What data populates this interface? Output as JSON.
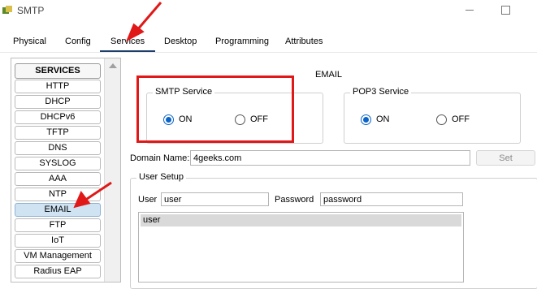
{
  "window": {
    "title": "SMTP"
  },
  "tabs": [
    "Physical",
    "Config",
    "Services",
    "Desktop",
    "Programming",
    "Attributes"
  ],
  "active_tab": "Services",
  "sidebar": {
    "header": "SERVICES",
    "items": [
      "HTTP",
      "DHCP",
      "DHCPv6",
      "TFTP",
      "DNS",
      "SYSLOG",
      "AAA",
      "NTP",
      "EMAIL",
      "FTP",
      "IoT",
      "VM Management",
      "Radius EAP"
    ],
    "selected": "EMAIL"
  },
  "content": {
    "title": "EMAIL",
    "smtp": {
      "label": "SMTP Service",
      "on_label": "ON",
      "off_label": "OFF",
      "state": "ON"
    },
    "pop3": {
      "label": "POP3 Service",
      "on_label": "ON",
      "off_label": "OFF",
      "state": "ON"
    },
    "domain": {
      "label": "Domain Name:",
      "value": "4geeks.com",
      "set_label": "Set"
    },
    "user_setup": {
      "label": "User Setup",
      "user_label": "User",
      "user_value": "user",
      "password_label": "Password",
      "password_value": "password",
      "users": [
        "user"
      ]
    }
  },
  "annotation_color": "#e01818"
}
